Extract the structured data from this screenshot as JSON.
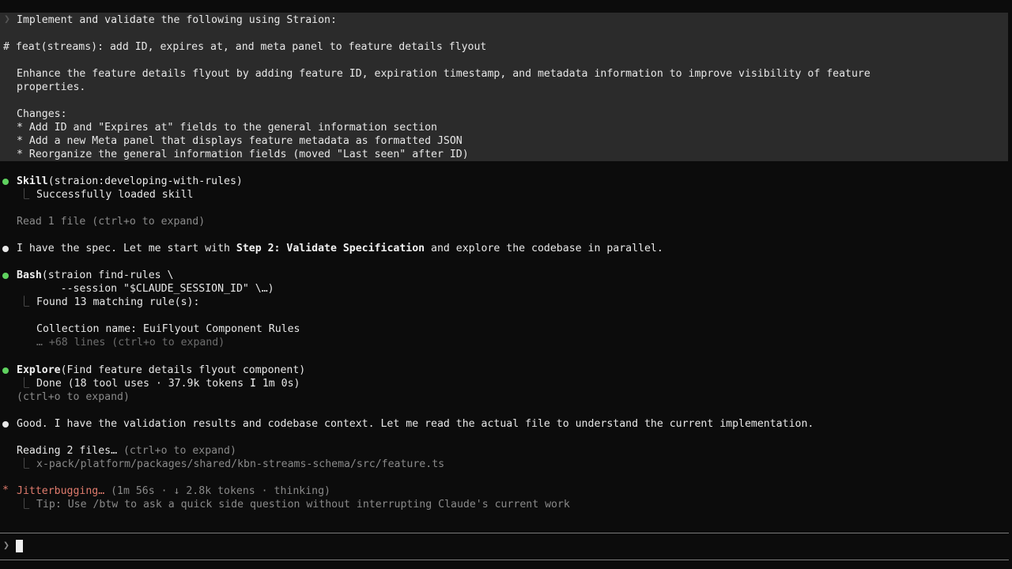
{
  "prompt": {
    "caret": "❯",
    "lines": [
      "Implement and validate the following using Straion:",
      "",
      "# feat(streams): add ID, expires at, and meta panel to feature details flyout",
      "",
      "Enhance the feature details flyout by adding feature ID, expiration timestamp, and metadata information to improve visibility of feature",
      "properties.",
      "",
      "Changes:",
      "* Add ID and \"Expires at\" fields to the general information section",
      "* Add a new Meta panel that displays feature metadata as formatted JSON",
      "* Reorganize the general information fields (moved \"Last seen\" after ID)"
    ]
  },
  "skill": {
    "name": "Skill",
    "args": "(straion:developing-with-rules)",
    "result": "Successfully loaded skill"
  },
  "read1": "Read 1 file (ctrl+o to expand)",
  "msg1": {
    "before": "I have the spec. Let me start with ",
    "bold": "Step 2: Validate Specification",
    "after": " and explore the codebase in parallel."
  },
  "bash": {
    "name": "Bash",
    "args_line1": "(straion find-rules \\",
    "args_line2": "      --session \"$CLAUDE_SESSION_ID\" \\…)",
    "result1": "Found 13 matching rule(s):",
    "result2": "Collection name: EuiFlyout Component Rules",
    "more": "… +68 lines (ctrl+o to expand)"
  },
  "explore": {
    "name": "Explore",
    "args": "(Find feature details flyout component)",
    "result_a": "Done (18 tool uses · 37.9k tokens ",
    "result_b": "1m 0s)",
    "expand": "(ctrl+o to expand)"
  },
  "msg2": "Good. I have the validation results and codebase context. Let me read the actual file to understand the current implementation.",
  "reading": {
    "label": "Reading 2 files… ",
    "hint": "(ctrl+o to expand)",
    "file": "x-pack/platform/packages/shared/kbn-streams-schema/src/feature.ts"
  },
  "status": {
    "star": "*",
    "word": "Jitterbugging…",
    "meta": " (1m 56s · ↓ 2.8k tokens · thinking)",
    "tip": "Tip: Use /btw to ask a quick side question without interrupting Claude's current work"
  },
  "input": {
    "caret": "❯",
    "value": ""
  },
  "colors": {
    "background": "#0c0c0c",
    "prompt_block": "#2b2b2b",
    "success_dot": "#5fd25f",
    "thinking": "#e07b6d"
  }
}
